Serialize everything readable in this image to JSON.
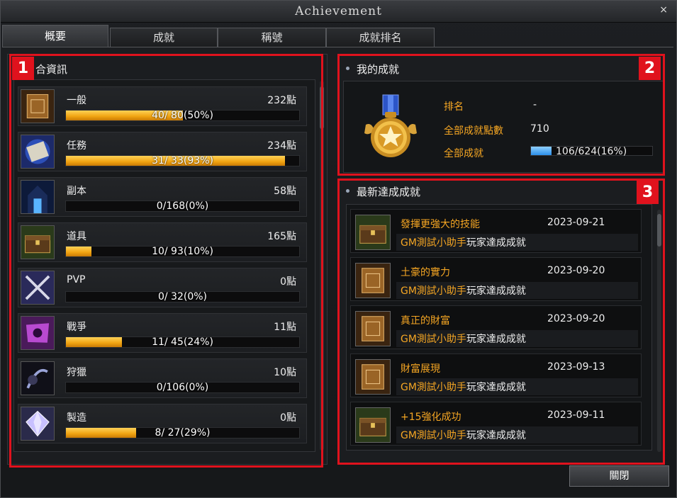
{
  "window": {
    "title": "Achievement",
    "close_glyph": "×"
  },
  "tabs": [
    {
      "label": "概要",
      "active": true
    },
    {
      "label": "成就",
      "active": false
    },
    {
      "label": "稱號",
      "active": false
    },
    {
      "label": "成就排名",
      "active": false
    }
  ],
  "annotations": [
    "1",
    "2",
    "3"
  ],
  "summary": {
    "title": "合資訊",
    "categories": [
      {
        "name": "一般",
        "points": "232點",
        "progress_text": "40/ 80(50%)",
        "fraction": 0.5,
        "icon": "book-icon"
      },
      {
        "name": "任務",
        "points": "234點",
        "progress_text": "31/ 33(93%)",
        "fraction": 0.94,
        "icon": "scroll-icon"
      },
      {
        "name": "副本",
        "points": "58點",
        "progress_text": "0/168(0%)",
        "fraction": 0.0,
        "icon": "dungeon-icon"
      },
      {
        "name": "道具",
        "points": "165點",
        "progress_text": "10/ 93(10%)",
        "fraction": 0.11,
        "icon": "chest-icon"
      },
      {
        "name": "PVP",
        "points": "0點",
        "progress_text": "0/ 32(0%)",
        "fraction": 0.0,
        "icon": "crossed-swords-icon"
      },
      {
        "name": "戰爭",
        "points": "11點",
        "progress_text": "11/ 45(24%)",
        "fraction": 0.24,
        "icon": "war-banner-icon"
      },
      {
        "name": "狩獵",
        "points": "10點",
        "progress_text": "0/106(0%)",
        "fraction": 0.0,
        "icon": "hunt-icon"
      },
      {
        "name": "製造",
        "points": "0點",
        "progress_text": "8/ 27(29%)",
        "fraction": 0.3,
        "icon": "crystal-icon"
      }
    ]
  },
  "mine": {
    "title": "我的成就",
    "rank_label": "排名",
    "rank_value": "-",
    "points_label": "全部成就點數",
    "points_value": "710",
    "total_label": "全部成就",
    "total_value": "106/624(16%)",
    "total_fraction": 0.17
  },
  "recent": {
    "title": "最新達成成就",
    "message": "玩家達成成就",
    "items": [
      {
        "name": "發揮更強大的技能",
        "date": "2023-09-21",
        "player": "GM測試小助手",
        "icon": "chest-icon"
      },
      {
        "name": "土豪的實力",
        "date": "2023-09-20",
        "player": "GM測試小助手",
        "icon": "book-icon"
      },
      {
        "name": "真正的財富",
        "date": "2023-09-20",
        "player": "GM測試小助手",
        "icon": "book-icon"
      },
      {
        "name": "財富展現",
        "date": "2023-09-13",
        "player": "GM測試小助手",
        "icon": "book-icon"
      },
      {
        "name": "+15強化成功",
        "date": "2023-09-11",
        "player": "GM測試小助手",
        "icon": "chest-icon"
      }
    ]
  },
  "footer": {
    "close_label": "關閉"
  },
  "colors": {
    "accent": "#f5a623",
    "annotation": "#e0121d",
    "progress": "#f0a311",
    "blue": "#2b8ee8"
  }
}
